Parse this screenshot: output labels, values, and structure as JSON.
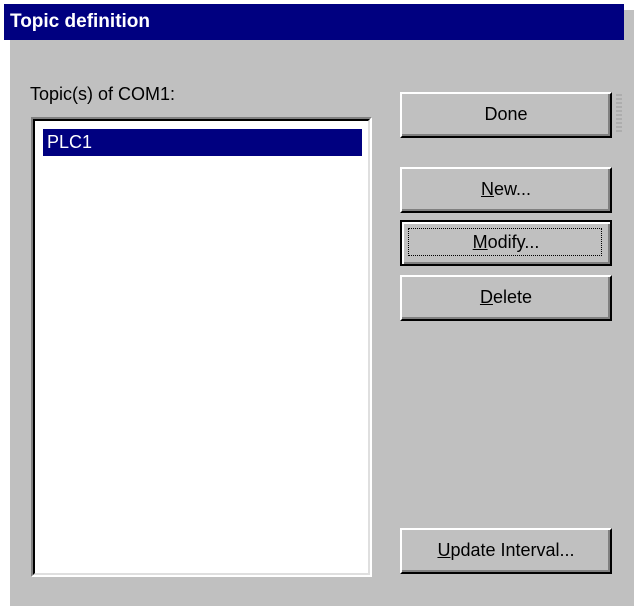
{
  "window": {
    "title": "Topic definition"
  },
  "topics": {
    "label": "Topic(s) of COM1:",
    "items": [
      "PLC1"
    ],
    "selected_index": 0
  },
  "buttons": {
    "done": {
      "label": "Done"
    },
    "new": {
      "mnemonic": "N",
      "rest": "ew..."
    },
    "modify": {
      "mnemonic": "M",
      "rest": "odify..."
    },
    "delete": {
      "mnemonic": "D",
      "rest": "elete"
    },
    "update_interval": {
      "mnemonic": "U",
      "rest": "pdate Interval..."
    }
  }
}
